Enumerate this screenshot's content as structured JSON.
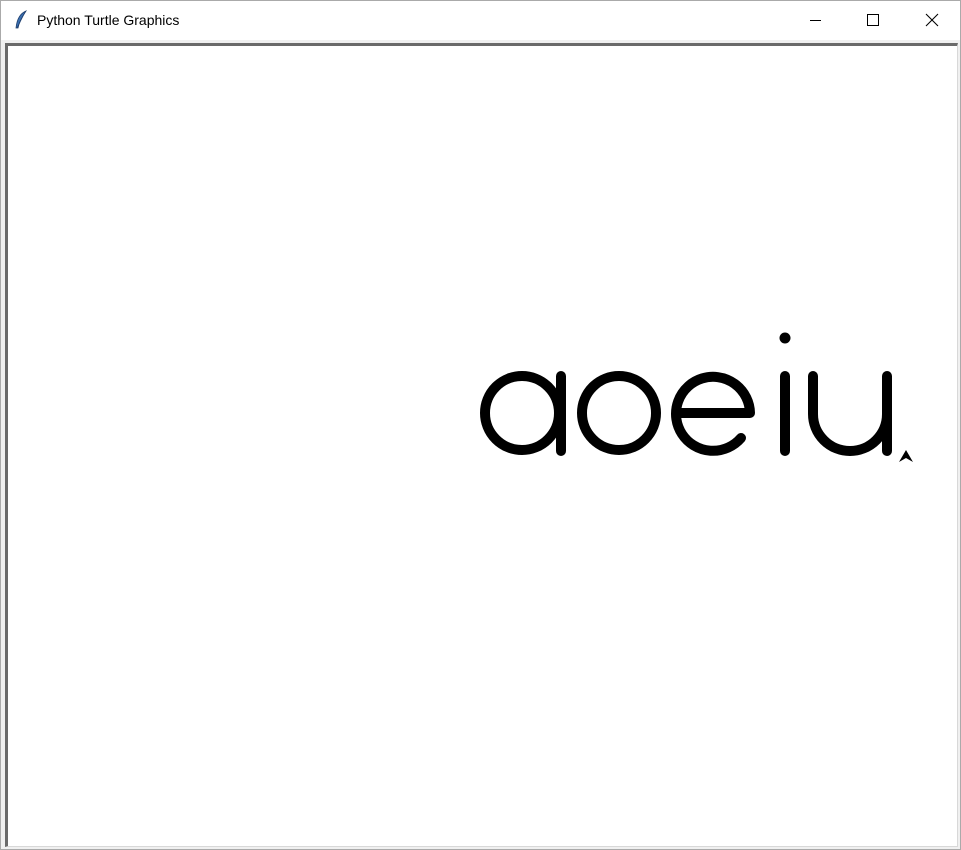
{
  "window": {
    "title": "Python Turtle Graphics",
    "app_icon": "feather-icon"
  },
  "caption_buttons": {
    "minimize_icon": "minimize-icon",
    "maximize_icon": "maximize-icon",
    "close_icon": "close-icon"
  },
  "canvas": {
    "background": "#ffffff",
    "pen_color": "#000000",
    "drawn_text": "aoeiu",
    "turtle_icon": "turtle-arrow-icon"
  }
}
